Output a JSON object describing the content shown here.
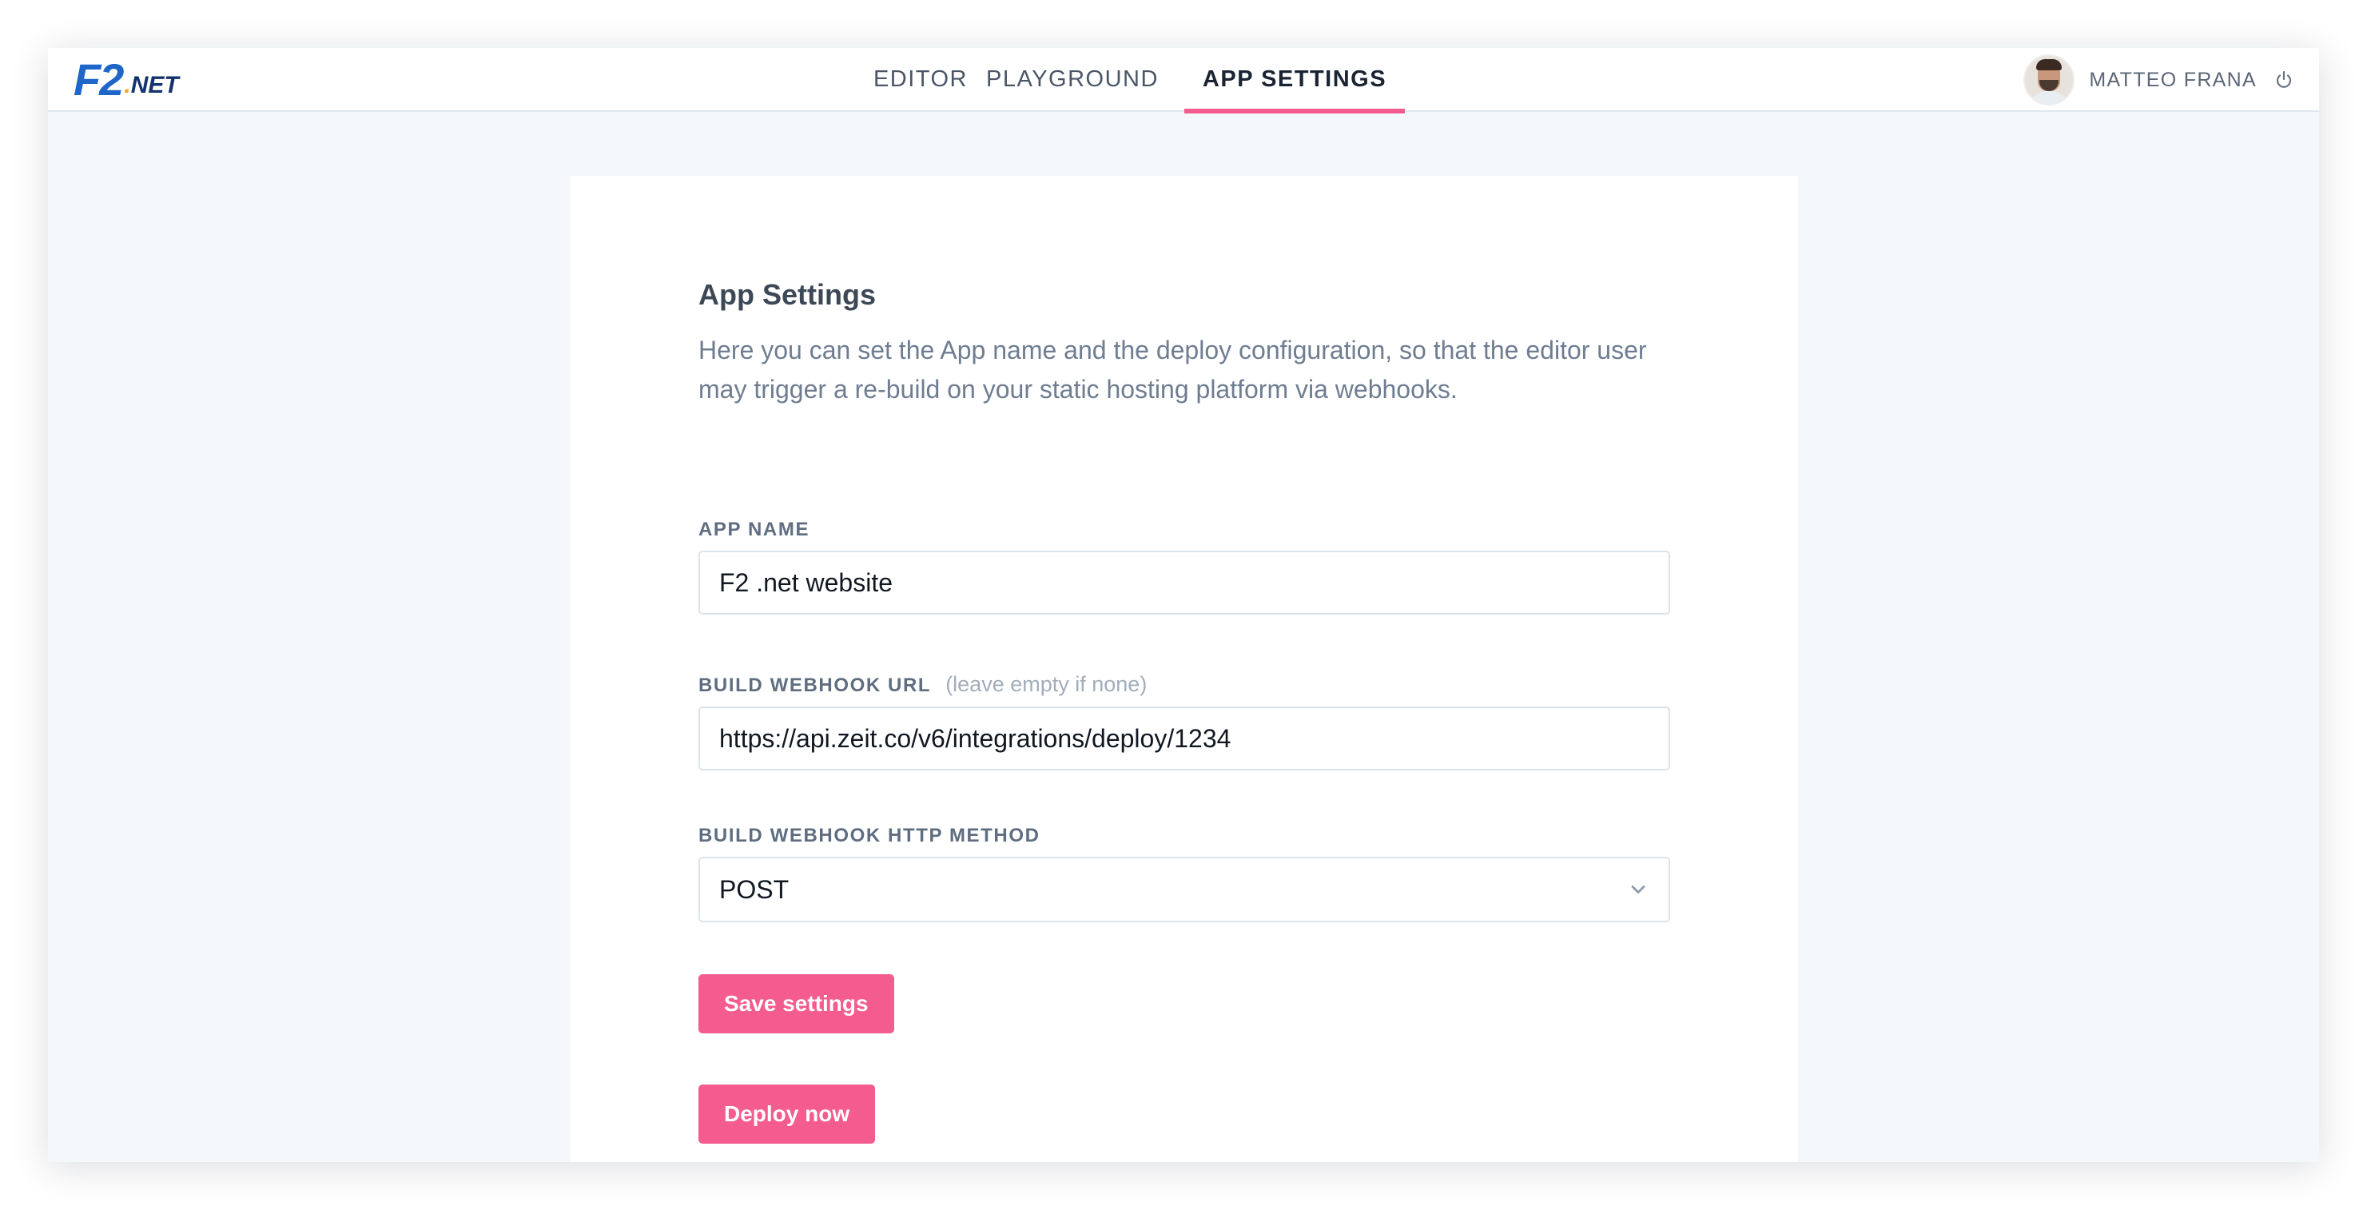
{
  "brand": {
    "logo_main": "F2",
    "logo_dot": ".",
    "logo_net": "NET"
  },
  "nav": {
    "tabs": [
      {
        "label": "EDITOR",
        "active": false
      },
      {
        "label": "PLAYGROUND",
        "active": false
      },
      {
        "label": "APP SETTINGS",
        "active": true
      }
    ]
  },
  "user": {
    "name": "MATTEO FRANA",
    "avatar_icon": "user-avatar",
    "logout_icon": "power-icon"
  },
  "settings": {
    "title": "App Settings",
    "description": "Here you can set the App name and the deploy configuration, so that the editor user may trigger a re-build on your static hosting platform via webhooks.",
    "app_name_label": "APP NAME",
    "app_name_value": "F2 .net website",
    "webhook_label": "BUILD WEBHOOK URL",
    "webhook_hint": "(leave empty if none)",
    "webhook_value": "https://api.zeit.co/v6/integrations/deploy/1234",
    "method_label": "BUILD WEBHOOK HTTP METHOD",
    "method_value": "POST",
    "save_label": "Save settings",
    "deploy_label": "Deploy now"
  },
  "colors": {
    "accent": "#f45c8f",
    "brand": "#1e66c8",
    "background": "#f5f8fb"
  }
}
